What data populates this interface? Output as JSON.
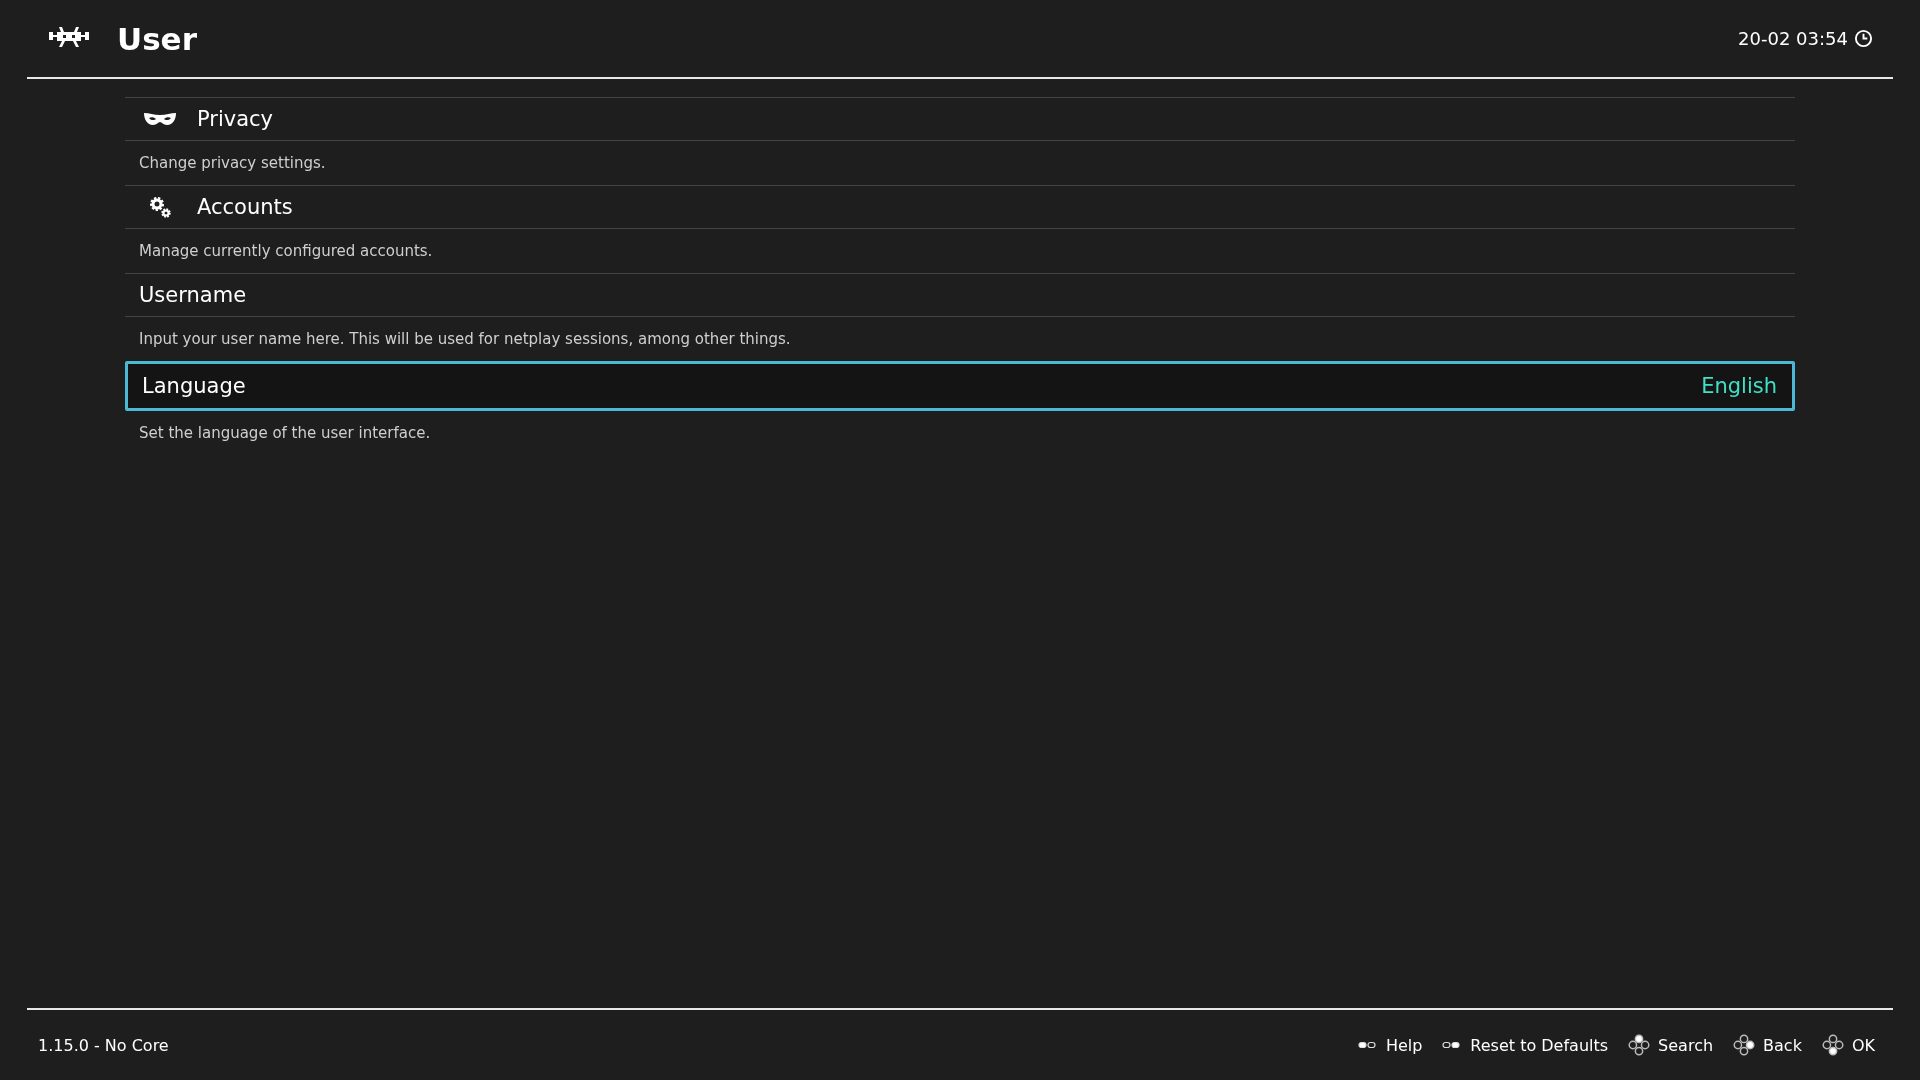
{
  "header": {
    "title": "User",
    "clock": "20-02 03:54"
  },
  "items": [
    {
      "label": "Privacy",
      "kind": "mask",
      "selected": false,
      "description": "Change privacy settings."
    },
    {
      "label": "Accounts",
      "kind": "gears",
      "selected": false,
      "description": "Manage currently configured accounts."
    },
    {
      "label": "Username",
      "selected": false,
      "description": "Input your user name here. This will be used for netplay sessions, among other things."
    },
    {
      "label": "Language",
      "value": "English",
      "selected": true,
      "description": "Set the language of the user interface."
    }
  ],
  "footer": {
    "version": "1.15.0 - No Core",
    "hints": [
      {
        "label": "Help",
        "kind": "select"
      },
      {
        "label": "Reset to Defaults",
        "kind": "start"
      },
      {
        "label": "Search",
        "kind": "north"
      },
      {
        "label": "Back",
        "kind": "east"
      },
      {
        "label": "OK",
        "kind": "south"
      }
    ]
  }
}
